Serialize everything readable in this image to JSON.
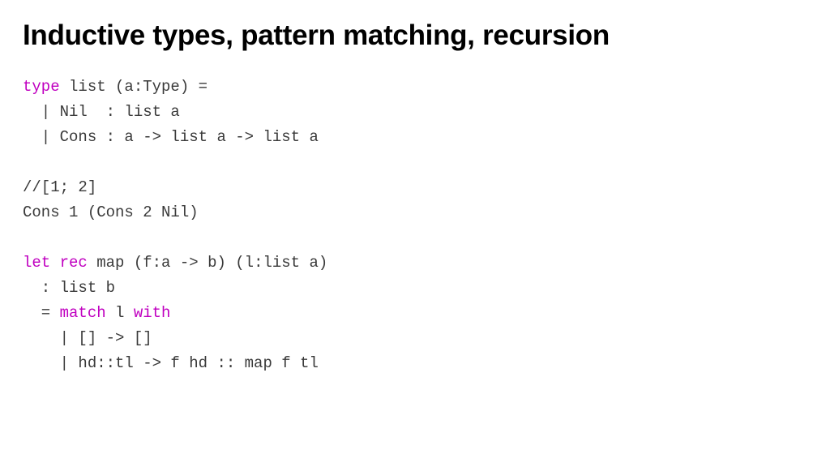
{
  "title": "Inductive types, pattern matching, recursion",
  "code": {
    "l1_kw": "type",
    "l1_rest": " list (a:Type) =",
    "l2": "  | Nil  : list a",
    "l3": "  | Cons : a -> list a -> list a",
    "l4": "",
    "l5": "//[1; 2]",
    "l6": "Cons 1 (Cons 2 Nil)",
    "l7": "",
    "l8_kw1": "let",
    "l8_sp1": " ",
    "l8_kw2": "rec",
    "l8_rest": " map (f:a -> b) (l:list a)",
    "l9": "  : list b",
    "l10_pre": "  = ",
    "l10_kw1": "match",
    "l10_mid": " l ",
    "l10_kw2": "with",
    "l11": "    | [] -> []",
    "l12": "    | hd::tl -> f hd :: map f tl"
  }
}
